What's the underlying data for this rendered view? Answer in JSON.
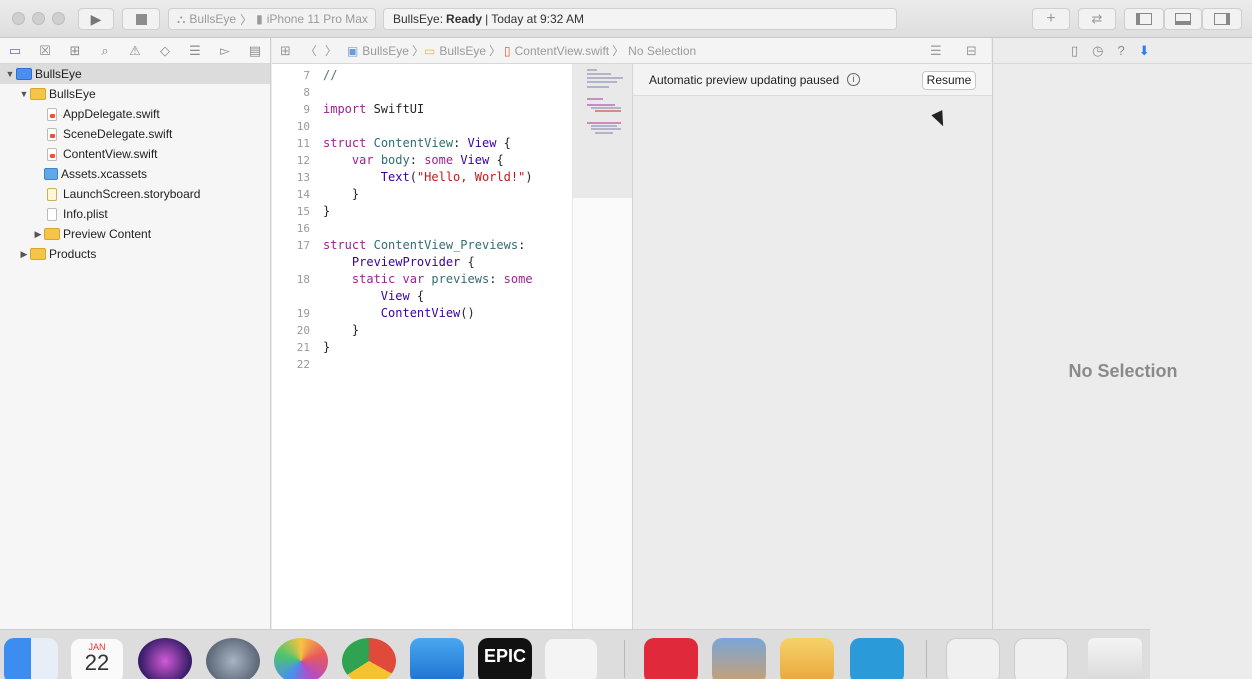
{
  "toolbar": {
    "scheme": "BullsEye",
    "device": "iPhone 11 Pro Max",
    "status_app": "BullsEye:",
    "status_state": "Ready",
    "status_time": "| Today at 9:32 AM"
  },
  "navigator": {
    "items": [
      {
        "label": "BullsEye",
        "level": 0,
        "expanded": true,
        "icon": "project-icon"
      },
      {
        "label": "BullsEye",
        "level": 1,
        "expanded": true,
        "icon": "folder-icon"
      },
      {
        "label": "AppDelegate.swift",
        "level": 2,
        "icon": "swift-file-icon"
      },
      {
        "label": "SceneDelegate.swift",
        "level": 2,
        "icon": "swift-file-icon"
      },
      {
        "label": "ContentView.swift",
        "level": 2,
        "icon": "swift-file-icon"
      },
      {
        "label": "Assets.xcassets",
        "level": 2,
        "icon": "assets-icon"
      },
      {
        "label": "LaunchScreen.storyboard",
        "level": 2,
        "icon": "storyboard-icon"
      },
      {
        "label": "Info.plist",
        "level": 2,
        "icon": "plist-icon"
      },
      {
        "label": "Preview Content",
        "level": 2,
        "expanded": false,
        "icon": "folder-icon"
      },
      {
        "label": "Products",
        "level": 1,
        "expanded": false,
        "icon": "folder-icon"
      }
    ]
  },
  "jumpbar": {
    "crumbs": [
      "BullsEye",
      "BullsEye",
      "ContentView.swift",
      "No Selection"
    ]
  },
  "editor": {
    "lines": [
      {
        "n": "7",
        "html": "<span class='cm'>//</span>"
      },
      {
        "n": "8",
        "html": ""
      },
      {
        "n": "9",
        "html": "<span class='kw'>import</span> SwiftUI"
      },
      {
        "n": "10",
        "html": ""
      },
      {
        "n": "11",
        "html": "<span class='kw'>struct</span> <span class='fn'>ContentView</span>: <span class='ty'>View</span> {"
      },
      {
        "n": "12",
        "html": "    <span class='kw'>var</span> <span class='fn'>body</span>: <span class='kw'>some</span> <span class='ty'>View</span> {"
      },
      {
        "n": "13",
        "html": "        <span class='ty'>Text</span>(<span class='str'>\"Hello, World!\"</span>)"
      },
      {
        "n": "14",
        "html": "    }"
      },
      {
        "n": "15",
        "html": "}"
      },
      {
        "n": "16",
        "html": ""
      },
      {
        "n": "17",
        "html": "<span class='kw'>struct</span> <span class='fn'>ContentView_Previews</span>:"
      },
      {
        "n": "",
        "html": "    <span class='ty'>PreviewProvider</span> {"
      },
      {
        "n": "18",
        "html": "    <span class='kw'>static</span> <span class='kw'>var</span> <span class='fn'>previews</span>: <span class='kw'>some</span>"
      },
      {
        "n": "",
        "html": "        <span class='ty'>View</span> {"
      },
      {
        "n": "19",
        "html": "        <span class='ty'>ContentView</span>()"
      },
      {
        "n": "20",
        "html": "    }"
      },
      {
        "n": "21",
        "html": "}"
      },
      {
        "n": "22",
        "html": ""
      }
    ]
  },
  "preview": {
    "message": "Automatic preview updating paused",
    "resume_label": "Resume"
  },
  "inspector": {
    "empty_text": "No Selection"
  },
  "dock": {
    "calendar_month": "JAN",
    "calendar_day": "22",
    "epic_label": "EPIC"
  }
}
